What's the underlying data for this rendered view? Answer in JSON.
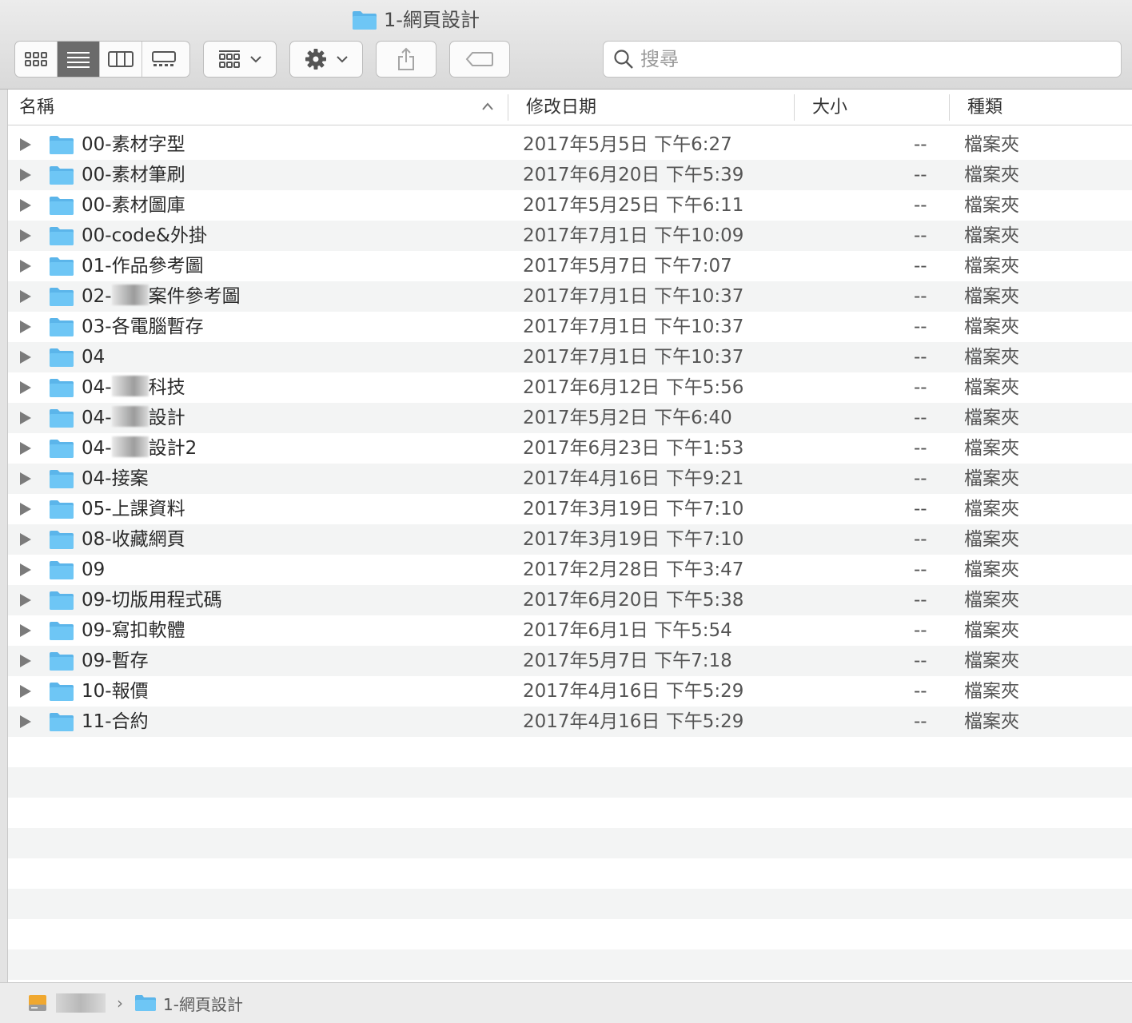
{
  "window": {
    "title": "1-網頁設計"
  },
  "toolbar": {
    "view_buttons": [
      {
        "icon": "icon-view-icon",
        "active": false
      },
      {
        "icon": "list-view-icon",
        "active": true
      },
      {
        "icon": "column-view-icon",
        "active": false
      },
      {
        "icon": "gallery-view-icon",
        "active": false
      }
    ],
    "group_icon": "group-by-icon",
    "action_icon": "gear-icon",
    "share_icon": "share-icon",
    "tags_icon": "tag-icon",
    "search_placeholder": "搜尋"
  },
  "columns": {
    "name": "名稱",
    "date": "修改日期",
    "size": "大小",
    "kind": "種類"
  },
  "rows": [
    {
      "name": "00-素材字型",
      "date": "2017年5月5日 下午6:27",
      "size": "--",
      "kind": "檔案夾"
    },
    {
      "name": "00-素材筆刷",
      "date": "2017年6月20日 下午5:39",
      "size": "--",
      "kind": "檔案夾"
    },
    {
      "name": "00-素材圖庫",
      "date": "2017年5月25日 下午6:11",
      "size": "--",
      "kind": "檔案夾"
    },
    {
      "name": "00-code&外掛",
      "date": "2017年7月1日 下午10:09",
      "size": "--",
      "kind": "檔案夾"
    },
    {
      "name": "01-作品參考圖",
      "date": "2017年5月7日 下午7:07",
      "size": "--",
      "kind": "檔案夾"
    },
    {
      "name_prefix": "02-",
      "name_suffix": "案件參考圖",
      "date": "2017年7月1日 下午10:37",
      "size": "--",
      "kind": "檔案夾"
    },
    {
      "name": "03-各電腦暫存",
      "date": "2017年7月1日 下午10:37",
      "size": "--",
      "kind": "檔案夾"
    },
    {
      "name": "04",
      "date": "2017年7月1日 下午10:37",
      "size": "--",
      "kind": "檔案夾"
    },
    {
      "name_prefix": "04-",
      "name_suffix": "科技",
      "date": "2017年6月12日 下午5:56",
      "size": "--",
      "kind": "檔案夾"
    },
    {
      "name_prefix": "04-",
      "name_suffix": "設計",
      "date": "2017年5月2日 下午6:40",
      "size": "--",
      "kind": "檔案夾"
    },
    {
      "name_prefix": "04-",
      "name_suffix": "設計2",
      "date": "2017年6月23日 下午1:53",
      "size": "--",
      "kind": "檔案夾"
    },
    {
      "name": "04-接案",
      "date": "2017年4月16日 下午9:21",
      "size": "--",
      "kind": "檔案夾"
    },
    {
      "name": "05-上課資料",
      "date": "2017年3月19日 下午7:10",
      "size": "--",
      "kind": "檔案夾"
    },
    {
      "name": "08-收藏網頁",
      "date": "2017年3月19日 下午7:10",
      "size": "--",
      "kind": "檔案夾"
    },
    {
      "name": "09",
      "date": "2017年2月28日 下午3:47",
      "size": "--",
      "kind": "檔案夾"
    },
    {
      "name": "09-切版用程式碼",
      "date": "2017年6月20日 下午5:38",
      "size": "--",
      "kind": "檔案夾"
    },
    {
      "name": "09-寫扣軟體",
      "date": "2017年6月1日 下午5:54",
      "size": "--",
      "kind": "檔案夾"
    },
    {
      "name": "09-暫存",
      "date": "2017年5月7日 下午7:18",
      "size": "--",
      "kind": "檔案夾"
    },
    {
      "name": "10-報價",
      "date": "2017年4月16日 下午5:29",
      "size": "--",
      "kind": "檔案夾"
    },
    {
      "name": "11-合約",
      "date": "2017年4月16日 下午5:29",
      "size": "--",
      "kind": "檔案夾"
    }
  ],
  "pathbar": {
    "current_folder": "1-網頁設計"
  },
  "colors": {
    "folder": "#6ec6f5",
    "folder_tab": "#5bb5ea",
    "row_alt": "#f3f4f4",
    "active_segment": "#6b6b6b"
  }
}
